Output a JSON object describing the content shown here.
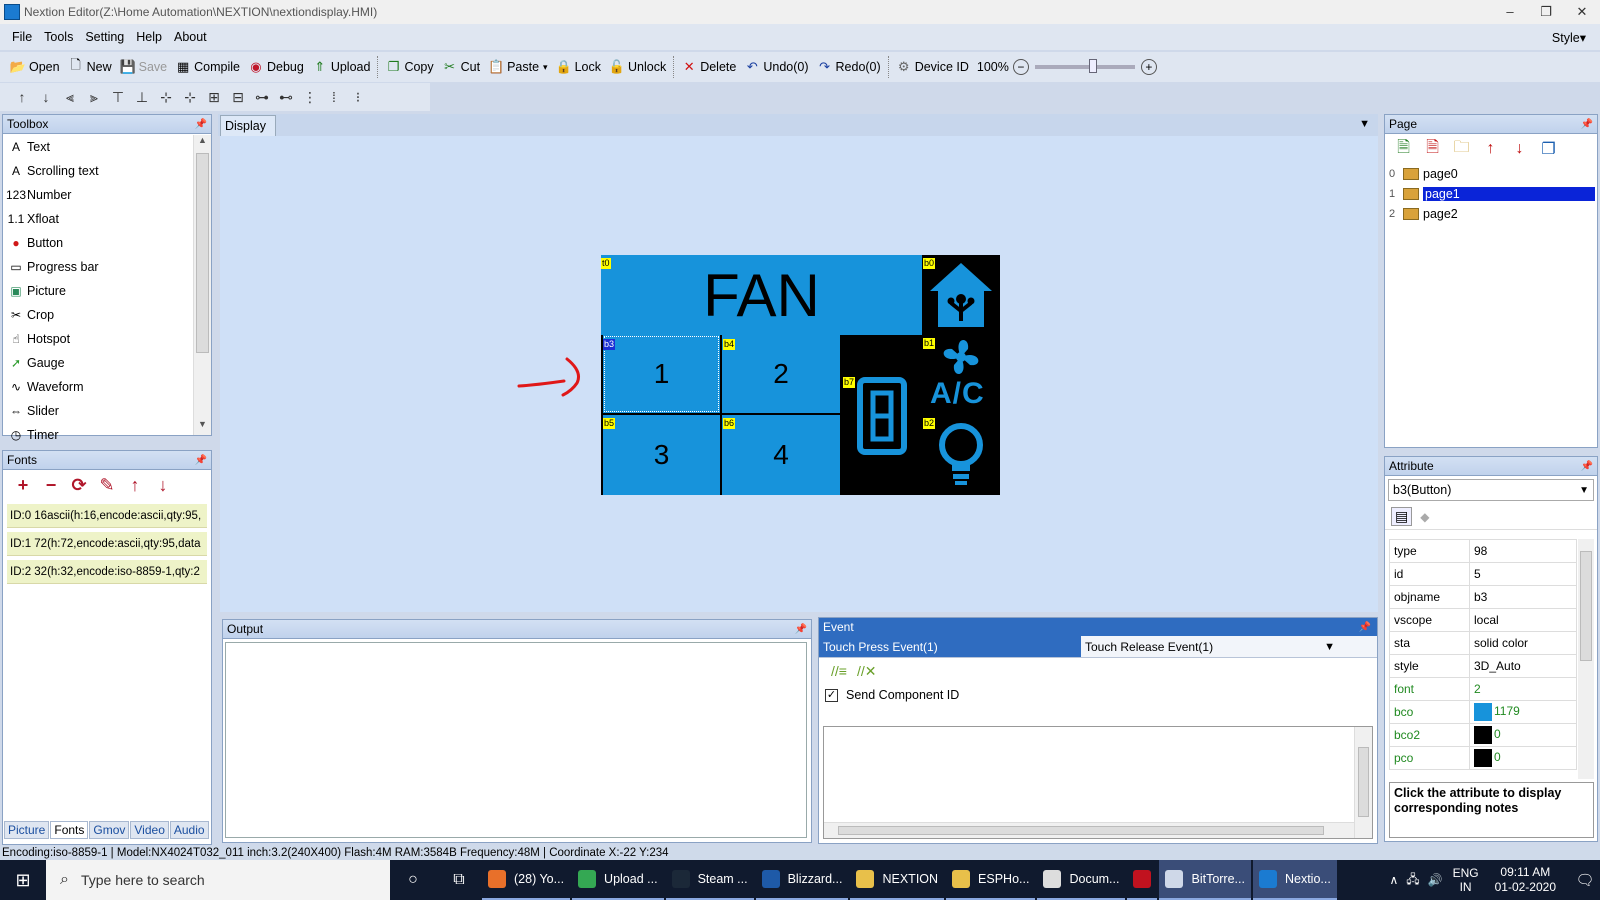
{
  "window": {
    "title": "Nextion Editor(Z:\\Home Automation\\NEXTION\\nextiondisplay.HMI)",
    "controls": [
      "‒",
      "❐",
      "✕"
    ]
  },
  "menu": {
    "items": [
      "File",
      "Tools",
      "Setting",
      "Help",
      "About"
    ],
    "style": "Style"
  },
  "toolbar": {
    "open": "Open",
    "new": "New",
    "save": "Save",
    "compile": "Compile",
    "debug": "Debug",
    "upload": "Upload",
    "copy": "Copy",
    "cut": "Cut",
    "paste": "Paste",
    "lock": "Lock",
    "unlock": "Unlock",
    "delete": "Delete",
    "undo": "Undo(0)",
    "redo": "Redo(0)",
    "device_id": "Device ID",
    "zoom": "100%"
  },
  "toolbox": {
    "title": "Toolbox",
    "items": [
      {
        "label": "Text",
        "icon": "A"
      },
      {
        "label": "Scrolling text",
        "icon": "A"
      },
      {
        "label": "Number",
        "icon": "123"
      },
      {
        "label": "Xfloat",
        "icon": "1.1"
      },
      {
        "label": "Button",
        "icon": "●"
      },
      {
        "label": "Progress bar",
        "icon": "▭"
      },
      {
        "label": "Picture",
        "icon": "▣"
      },
      {
        "label": "Crop",
        "icon": "✂"
      },
      {
        "label": "Hotspot",
        "icon": "☝"
      },
      {
        "label": "Gauge",
        "icon": "➚"
      },
      {
        "label": "Waveform",
        "icon": "∿"
      },
      {
        "label": "Slider",
        "icon": "⇔"
      },
      {
        "label": "Timer",
        "icon": "◷"
      }
    ]
  },
  "fonts": {
    "title": "Fonts",
    "rows": [
      "ID:0  16ascii(h:16,encode:ascii,qty:95,",
      "ID:1  72(h:72,encode:ascii,qty:95,data",
      "ID:2  32(h:32,encode:iso-8859-1,qty:2"
    ]
  },
  "bottom_tabs": [
    "Picture",
    "Fonts",
    "Gmov",
    "Video",
    "Audio"
  ],
  "display": {
    "tab": "Display",
    "hmi": {
      "title_text": "FAN",
      "tags": {
        "t0": "t0",
        "b0": "b0",
        "b1": "b1",
        "b2": "b2",
        "b3": "b3",
        "b4": "b4",
        "b5": "b5",
        "b6": "b6",
        "b7": "b7"
      },
      "buttons": [
        "1",
        "2",
        "3",
        "4"
      ],
      "ac_label": "A/C",
      "bco_color": "#1793db"
    }
  },
  "output": {
    "title": "Output"
  },
  "event": {
    "title": "Event",
    "tab_press": "Touch Press Event(1)",
    "tab_release": "Touch Release Event(1)",
    "send_component_id": "Send Component ID"
  },
  "page": {
    "title": "Page",
    "pages": [
      {
        "num": "0",
        "name": "page0"
      },
      {
        "num": "1",
        "name": "page1"
      },
      {
        "num": "2",
        "name": "page2"
      }
    ]
  },
  "attribute": {
    "title": "Attribute",
    "selected": "b3(Button)",
    "rows": [
      {
        "k": "type",
        "v": "98"
      },
      {
        "k": "id",
        "v": "5"
      },
      {
        "k": "objname",
        "v": "b3"
      },
      {
        "k": "vscope",
        "v": "local"
      },
      {
        "k": "sta",
        "v": "solid color"
      },
      {
        "k": "style",
        "v": "3D_Auto"
      },
      {
        "k": "font",
        "v": "2"
      },
      {
        "k": "bco",
        "v": "1179"
      },
      {
        "k": "bco2",
        "v": "0"
      },
      {
        "k": "pco",
        "v": "0"
      }
    ],
    "notes": "Click the attribute to display corresponding notes"
  },
  "status": {
    "text": "Encoding:iso-8859-1 | Model:NX4024T032_011 inch:3.2(240X400) Flash:4M RAM:3584B Frequency:48M |    Coordinate X:-22  Y:234"
  },
  "taskbar": {
    "search_placeholder": "Type here to search",
    "tasks": [
      {
        "label": "(28) Yo...",
        "color": "#e8702a"
      },
      {
        "label": "Upload ...",
        "color": "#34a853"
      },
      {
        "label": "Steam ...",
        "color": "#1b2838"
      },
      {
        "label": "Blizzard...",
        "color": "#1e5aa8"
      },
      {
        "label": "NEXTION",
        "color": "#e8c04a"
      },
      {
        "label": "ESPHo...",
        "color": "#e8c04a"
      },
      {
        "label": "Docum...",
        "color": "#dddddd"
      },
      {
        "label": "",
        "color": "#c1121f"
      },
      {
        "label": "BitTorre...",
        "color": "#cfd8e8"
      },
      {
        "label": "Nextio...",
        "color": "#1b7bd1"
      }
    ],
    "lang_top": "ENG",
    "lang_bottom": "IN",
    "time": "09:11 AM",
    "date": "01-02-2020"
  }
}
